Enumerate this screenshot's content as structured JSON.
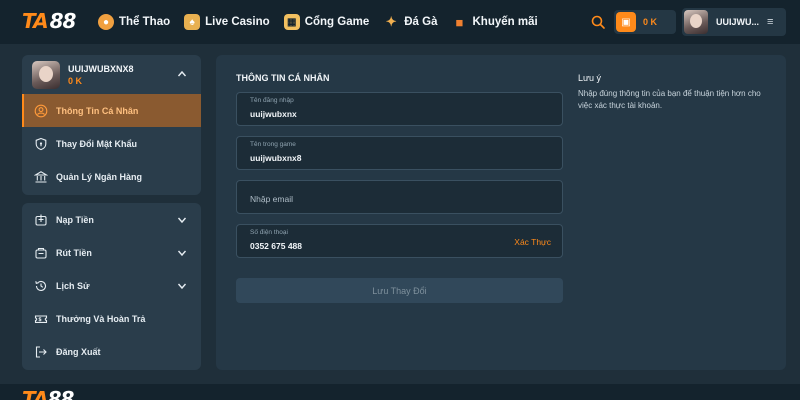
{
  "brand": {
    "logo_left": "TA",
    "logo_right": "88"
  },
  "nav": [
    {
      "label": "Thể Thao",
      "icon": "soccer-icon"
    },
    {
      "label": "Live Casino",
      "icon": "cards-icon"
    },
    {
      "label": "Cổng Game",
      "icon": "game-icon"
    },
    {
      "label": "Đá Gà",
      "icon": "rooster-icon"
    },
    {
      "label": "Khuyến mãi",
      "icon": "gift-icon"
    }
  ],
  "header": {
    "balance": "0 K",
    "username_short": "UUIJWU..."
  },
  "profile": {
    "username": "UUIJWUBXNX8",
    "balance": "0 K"
  },
  "account_menu": [
    {
      "label": "Thông Tin Cá Nhân",
      "active": true
    },
    {
      "label": "Thay Đổi Mật Khẩu",
      "active": false
    },
    {
      "label": "Quản Lý Ngân Hàng",
      "active": false
    }
  ],
  "main_menu": [
    {
      "label": "Nạp Tiền",
      "expandable": true
    },
    {
      "label": "Rút Tiền",
      "expandable": true
    },
    {
      "label": "Lịch Sử",
      "expandable": true
    },
    {
      "label": "Thưởng Và Hoàn Trả",
      "expandable": false
    },
    {
      "label": "Đăng Xuất",
      "expandable": false
    }
  ],
  "form": {
    "title": "THÔNG TIN CÁ NHÂN",
    "username_label": "Tên đăng nhập",
    "username_value": "uuijwubxnx",
    "ingame_label": "Tên trong game",
    "ingame_value": "uuijwubxnx8",
    "email_placeholder": "Nhập email",
    "phone_label": "Số điện thoại",
    "phone_value": "0352 675 488",
    "verify_label": "Xác Thực",
    "save_label": "Lưu Thay Đổi"
  },
  "note": {
    "title": "Lưu ý",
    "text": "Nhập đúng thông tin của bạn để thuận tiện hơn cho việc xác thực tài khoản."
  },
  "colors": {
    "accent": "#ff8a1a",
    "bg": "#1f2f3a",
    "panel": "#253846",
    "topbar": "#14232d"
  }
}
